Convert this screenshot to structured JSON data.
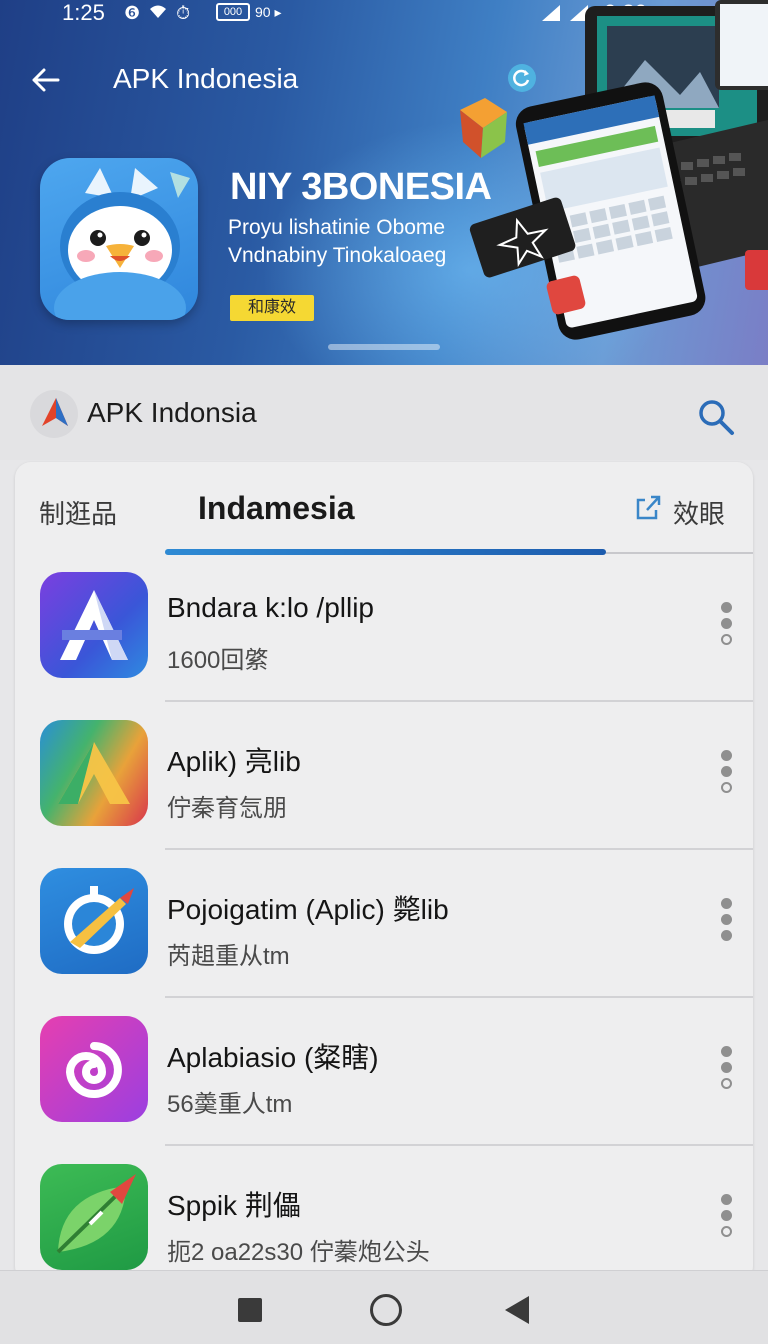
{
  "status_bar": {
    "time_left": "1:25",
    "battery_text": "000",
    "extra_text": "90 ▸",
    "time_right": "0:30"
  },
  "hero": {
    "title": "APK Indonesia",
    "heading": "NIY 3BONESIA",
    "subtitle_line1": "Proyu lishatinie Obome",
    "subtitle_line2": "Vndnabiny Tinokaloaeg",
    "badge": "和康效"
  },
  "app_bar": {
    "brand_name": "APK Indonsia"
  },
  "tabs": {
    "left_label": "制逛品",
    "active_label": "Indamesia",
    "right_label": "效眼"
  },
  "apps": [
    {
      "title": "Bndara k:lo /pllip",
      "subtitle": "1600回綮"
    },
    {
      "title": "Aplik) 亮lib",
      "subtitle": "佇秦育忥朋"
    },
    {
      "title": "Pojoigatim (Aplic) 斃lib",
      "subtitle": "芮趄重从tm"
    },
    {
      "title": "Aplabiasio (粲瞎)",
      "subtitle": "56羮重人tm"
    },
    {
      "title": "Sppik 荆儡",
      "subtitle": "扼2 oa22s30  佇蓁炮公头"
    }
  ],
  "colors": {
    "tab_indicator": "#1d5cae",
    "badge_yellow": "#f5d833",
    "hero_blue": "#2a5aa3"
  }
}
